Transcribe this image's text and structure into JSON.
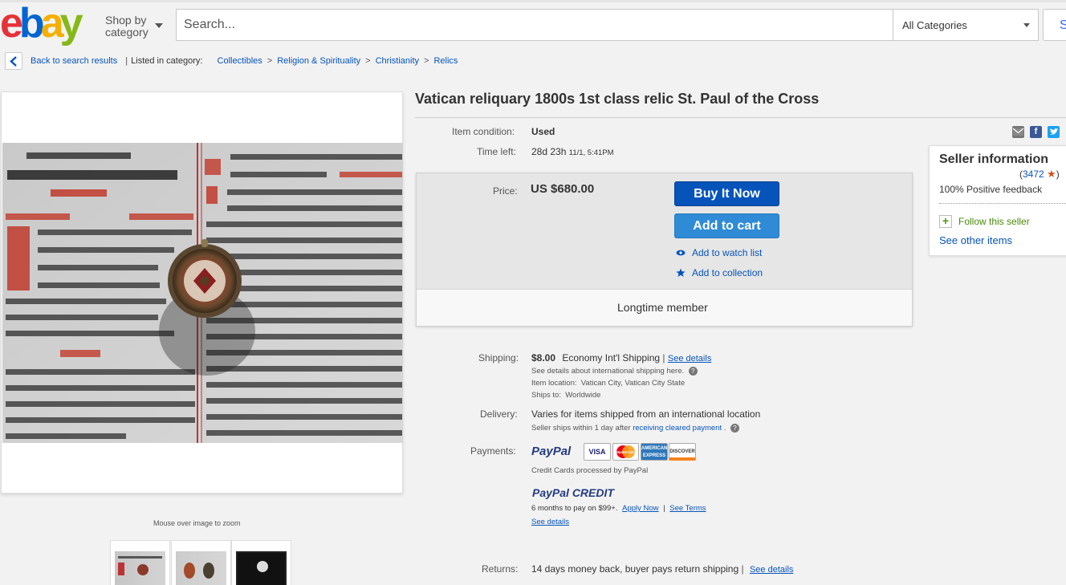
{
  "header": {
    "logo_text": [
      "e",
      "b",
      "a",
      "y"
    ],
    "shop_by": "Shop by category",
    "search_placeholder": "Search...",
    "category": "All Categories",
    "search_button": "S"
  },
  "breadcrumb": {
    "back": "Back to search results",
    "listed_in": "Listed in category:",
    "items": [
      "Collectibles",
      "Religion & Spirituality",
      "Christianity",
      "Relics"
    ]
  },
  "gallery": {
    "zoom_hint": "Mouse over image to zoom"
  },
  "item": {
    "title": "Vatican reliquary 1800s 1st class relic St. Paul of the Cross",
    "condition_label": "Item condition:",
    "condition_value": "Used",
    "time_label": "Time left:",
    "time_value": "28d 23h",
    "time_end": "11/1, 5:41PM",
    "price_label": "Price:",
    "price_value": "US $680.00",
    "buy_now": "Buy It Now",
    "add_to_cart": "Add to cart",
    "watch": "Add to watch list",
    "collection": "Add to collection",
    "longtime": "Longtime member"
  },
  "seller": {
    "title": "Seller information",
    "score": "3472",
    "feedback": "100% Positive feedback",
    "follow": "Follow this seller",
    "see_other": "See other items"
  },
  "shipping": {
    "label": "Shipping:",
    "cost": "$8.00",
    "method": "Economy Int'l Shipping",
    "see_details": "See details",
    "intl_note": "See details about international shipping here.",
    "location_label": "Item location:",
    "location": "Vatican City, Vatican City State",
    "ships_label": "Ships to:",
    "ships_to": "Worldwide"
  },
  "delivery": {
    "label": "Delivery:",
    "value": "Varies for items shipped from an international location",
    "note_prefix": "Seller ships within 1 day after",
    "note_link": "receiving cleared payment"
  },
  "payments": {
    "label": "Payments:",
    "paypal": "PayPal",
    "cards": [
      "VISA",
      "MasterCard",
      "AMERICAN EXPRESS",
      "DISCOVER"
    ],
    "processed": "Credit Cards processed by PayPal",
    "credit_logo": "PayPal CREDIT",
    "credit_offer": "6 months to pay on $99+.",
    "apply": "Apply Now",
    "terms": "See Terms",
    "see_details": "See details"
  },
  "returns": {
    "label": "Returns:",
    "value": "14 days money back, buyer pays return shipping",
    "see_details": "See details"
  },
  "colors": {
    "buy_now": "#0654ba",
    "add_to_cart": "#2f8bd6",
    "link": "#0654ba"
  }
}
